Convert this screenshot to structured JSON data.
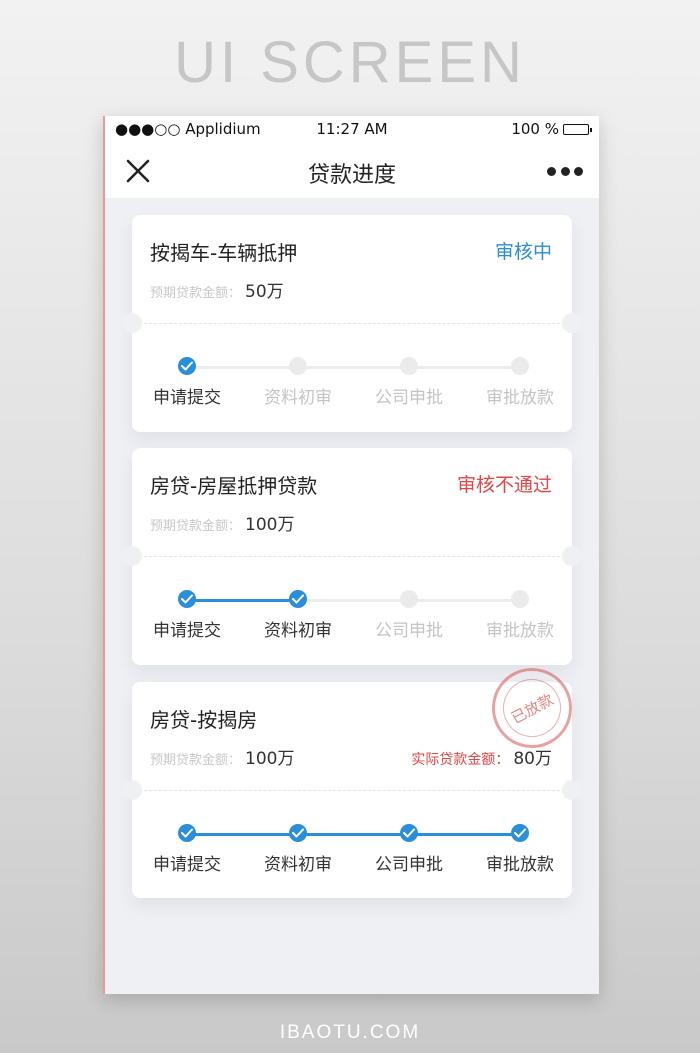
{
  "headline": "UI SCREEN",
  "footer": "IBAOTU.COM",
  "status_bar": {
    "carrier": "●●●○○ Applidium",
    "time": "11:27 AM",
    "battery": "100 %"
  },
  "nav": {
    "title": "贷款进度",
    "close_icon": "close-icon",
    "more_icon": "more-icon"
  },
  "colors": {
    "accent": "#2a8ed8",
    "reject": "#e54545",
    "stamp": "#dc5050"
  },
  "cards": [
    {
      "title": "按揭车-车辆抵押",
      "status": "审核中",
      "status_color": "#2a8ed8",
      "amount_label": "预期贷款金额：",
      "amount": "50万",
      "progress_completed": 1,
      "steps": [
        "申请提交",
        "资料初审",
        "公司申批",
        "审批放款"
      ]
    },
    {
      "title": "房贷-房屋抵押贷款",
      "status": "审核不通过",
      "status_color": "#e54545",
      "amount_label": "预期贷款金额：",
      "amount": "100万",
      "progress_completed": 2,
      "steps": [
        "申请提交",
        "资料初审",
        "公司申批",
        "审批放款"
      ]
    },
    {
      "title": "房贷-按揭房",
      "stamp": "已放款",
      "amount_label": "预期贷款金额：",
      "amount": "100万",
      "actual_label": "实际贷款金额：",
      "actual_amount": "80万",
      "progress_completed": 4,
      "steps": [
        "申请提交",
        "资料初审",
        "公司申批",
        "审批放款"
      ]
    }
  ]
}
